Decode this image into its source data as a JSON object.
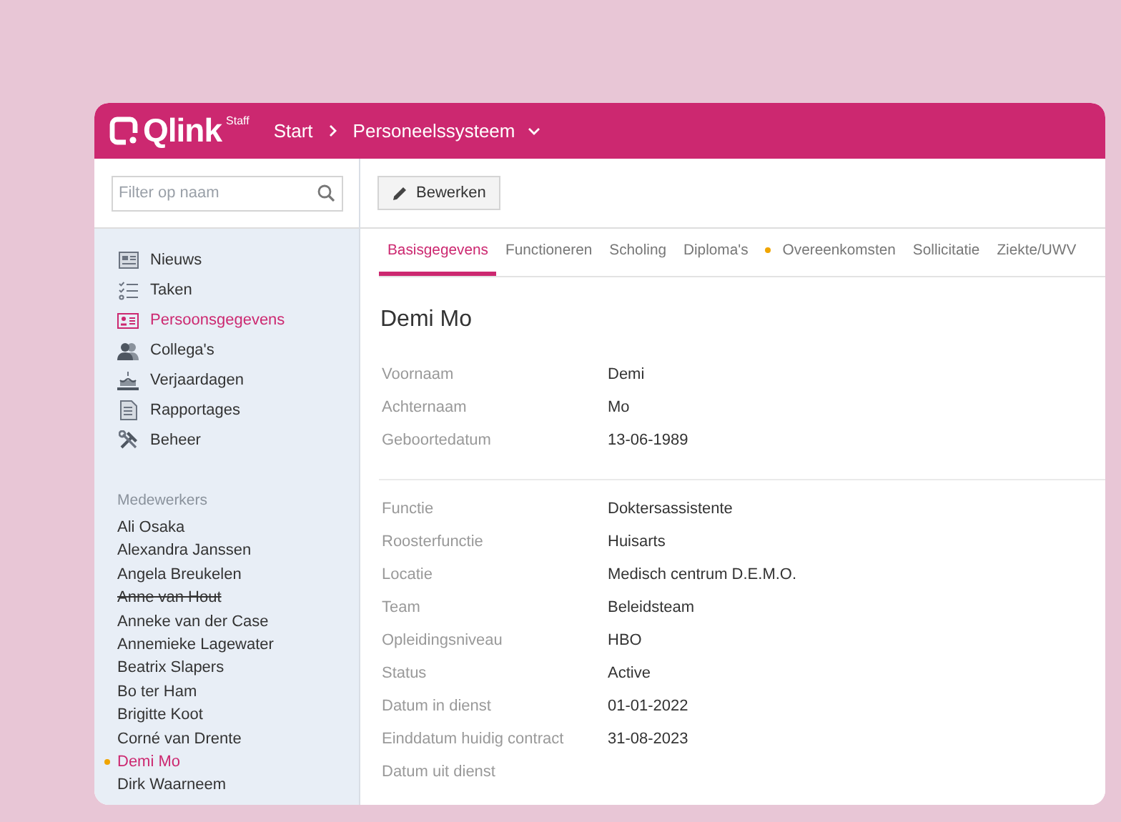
{
  "header": {
    "logo": "Qlink",
    "logo_suffix": "Staff",
    "breadcrumb": [
      "Start",
      "Personeelssysteem"
    ]
  },
  "sidebar": {
    "filter": {
      "placeholder": "Filter op naam"
    },
    "nav": [
      {
        "label": "Nieuws",
        "selected": false
      },
      {
        "label": "Taken",
        "selected": false
      },
      {
        "label": "Persoonsgegevens",
        "selected": true
      },
      {
        "label": "Collega's",
        "selected": false
      },
      {
        "label": "Verjaardagen",
        "selected": false
      },
      {
        "label": "Rapportages",
        "selected": false
      },
      {
        "label": "Beheer",
        "selected": false
      }
    ],
    "section_title": "Medewerkers",
    "employees": [
      {
        "name": "Ali Osaka",
        "selected": false,
        "struck": false,
        "flagged": false
      },
      {
        "name": "Alexandra Janssen",
        "selected": false,
        "struck": false,
        "flagged": false
      },
      {
        "name": "Angela Breukelen",
        "selected": false,
        "struck": false,
        "flagged": false
      },
      {
        "name": "Anne van Hout",
        "selected": false,
        "struck": true,
        "flagged": false
      },
      {
        "name": "Anneke van der Case",
        "selected": false,
        "struck": false,
        "flagged": false
      },
      {
        "name": "Annemieke Lagewater",
        "selected": false,
        "struck": false,
        "flagged": false
      },
      {
        "name": "Beatrix Slapers",
        "selected": false,
        "struck": false,
        "flagged": false
      },
      {
        "name": "Bo ter Ham",
        "selected": false,
        "struck": false,
        "flagged": false
      },
      {
        "name": "Brigitte Koot",
        "selected": false,
        "struck": false,
        "flagged": false
      },
      {
        "name": "Corné van Drente",
        "selected": false,
        "struck": false,
        "flagged": false
      },
      {
        "name": "Demi Mo",
        "selected": true,
        "struck": false,
        "flagged": true
      },
      {
        "name": "Dirk Waarneem",
        "selected": false,
        "struck": false,
        "flagged": false
      }
    ]
  },
  "toolbar": {
    "edit_button": "Bewerken"
  },
  "tabs": [
    {
      "label": "Basisgegevens",
      "selected": true,
      "flagged": false
    },
    {
      "label": "Functioneren",
      "selected": false,
      "flagged": false
    },
    {
      "label": "Scholing",
      "selected": false,
      "flagged": false
    },
    {
      "label": "Diploma's",
      "selected": false,
      "flagged": false
    },
    {
      "label": "Overeenkomsten",
      "selected": false,
      "flagged": true
    },
    {
      "label": "Sollicitatie",
      "selected": false,
      "flagged": false
    },
    {
      "label": "Ziekte/UWV",
      "selected": false,
      "flagged": false
    }
  ],
  "person": {
    "name": "Demi Mo",
    "sections": [
      [
        {
          "label": "Voornaam",
          "value": "Demi"
        },
        {
          "label": "Achternaam",
          "value": "Mo"
        },
        {
          "label": "Geboortedatum",
          "value": "13-06-1989"
        }
      ],
      [
        {
          "label": "Functie",
          "value": "Doktersassistente"
        },
        {
          "label": "Roosterfunctie",
          "value": "Huisarts"
        },
        {
          "label": "Locatie",
          "value": "Medisch centrum D.E.M.O."
        },
        {
          "label": "Team",
          "value": "Beleidsteam"
        },
        {
          "label": "Opleidingsniveau",
          "value": "HBO"
        },
        {
          "label": "Status",
          "value": "Active"
        },
        {
          "label": "Datum in dienst",
          "value": "01-01-2022"
        },
        {
          "label": "Einddatum huidig contract",
          "value": "31-08-2023"
        },
        {
          "label": "Datum uit dienst"
        }
      ]
    ]
  }
}
